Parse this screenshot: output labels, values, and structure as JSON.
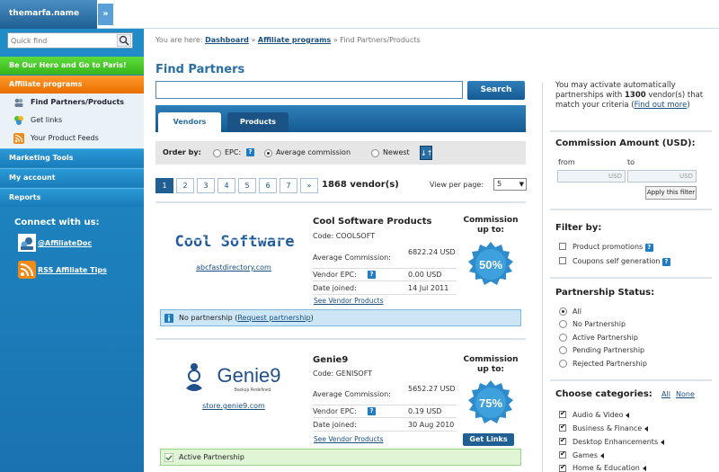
{
  "header": {
    "site_name": "themarfa.name",
    "expand_label": "»"
  },
  "sidebar": {
    "quick_find_placeholder": "Quick find",
    "promo": "Be Our Hero and Go to Paris!",
    "affiliate_programs": "Affiliate programs",
    "sub_items": [
      "Find Partners/Products",
      "Get links",
      "Your Product Feeds"
    ],
    "sections": [
      "Marketing Tools",
      "My account",
      "Reports"
    ],
    "connect_title": "Connect with us:",
    "connect_items": [
      "@AffiliateDoc",
      "RSS Affiliate Tips"
    ]
  },
  "breadcrumb": {
    "prefix": "You are here:",
    "items": [
      "Dashboard",
      "Affiliate programs"
    ],
    "current": "Find Partners/Products",
    "sep": "»"
  },
  "main": {
    "title": "Find Partners",
    "search_value": "",
    "search_button": "Search",
    "tabs": [
      "Vendors",
      "Products"
    ],
    "order_by_label": "Order by:",
    "order_options": [
      "EPC:",
      "Average commission",
      "Newest"
    ],
    "help_mark": "?",
    "sort_icon": "↓↑",
    "pages": [
      "1",
      "2",
      "3",
      "4",
      "5",
      "6",
      "7",
      "»"
    ],
    "vendor_count": "1868 vendor(s)",
    "per_page_label": "View per page:",
    "per_page_value": "5"
  },
  "vendors": [
    {
      "logo_text": "Cool Software",
      "url": "abcfastdirectory.com",
      "name": "Cool Software Products",
      "code": "Code: COOLSOFT",
      "stats": [
        {
          "k": "Average Commission:",
          "v": "6822.24 USD"
        },
        {
          "k": "Vendor EPC:",
          "v": "0.00 USD"
        },
        {
          "k": "Date joined:",
          "v": "14 Jul 2011"
        }
      ],
      "see_products": "See Vendor Products",
      "commission_title": "Commission up to:",
      "commission": "50%",
      "status_prefix": "No partnership (",
      "status_link": "Request partnership",
      "status_suffix": ")"
    },
    {
      "logo_text": "Genie9",
      "logo_tagline": "Backup Redefined",
      "url": "store.genie9.com",
      "name": "Genie9",
      "code": "Code: GENISOFT",
      "stats": [
        {
          "k": "Average Commission:",
          "v": "5652.27 USD"
        },
        {
          "k": "Vendor EPC:",
          "v": "0.19 USD"
        },
        {
          "k": "Date joined:",
          "v": "30 Aug 2010"
        }
      ],
      "see_products": "See Vendor Products",
      "commission_title": "Commission up to:",
      "commission": "75%",
      "get_links": "Get Links",
      "status": "Active Partnership"
    }
  ],
  "right": {
    "auto_pre": "You may activate automatically partnerships with ",
    "auto_num": "1300",
    "auto_post": " vendor(s) that match your criteria (",
    "auto_link": "Find out more",
    "auto_end": ")",
    "commission_title": "Commission Amount (USD):",
    "from_label": "from",
    "to_label": "to",
    "currency": "USD",
    "apply_button": "Apply this filter",
    "filter_title": "Filter by:",
    "filters": [
      "Product promotions",
      "Coupons self generation"
    ],
    "status_title": "Partnership Status:",
    "statuses": [
      "All",
      "No Partnership",
      "Active Partnership",
      "Pending Partnership",
      "Rejected Partnership"
    ],
    "categories_title": "Choose categories:",
    "all_link": "All",
    "none_link": "None",
    "categories": [
      "Audio & Video",
      "Business & Finance",
      "Desktop Enhancements",
      "Games",
      "Home & Education"
    ]
  }
}
